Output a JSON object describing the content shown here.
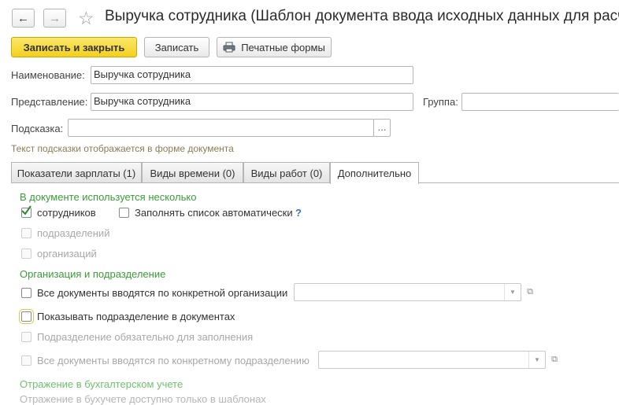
{
  "nav": {
    "back_icon": "arrow-left",
    "forward_icon": "arrow-right",
    "favorite_icon": "star"
  },
  "window": {
    "title": "Выручка сотрудника (Шаблон документа ввода исходных данных для расче"
  },
  "toolbar": {
    "save_close": "Записать и закрыть",
    "save": "Записать",
    "print_forms": "Печатные формы"
  },
  "form": {
    "name_label": "Наименование:",
    "name_value": "Выручка сотрудника",
    "presentation_label": "Представление:",
    "presentation_value": "Выручка сотрудника",
    "group_label": "Группа:",
    "group_value": "",
    "tooltip_label": "Подсказка:",
    "tooltip_value": "",
    "tooltip_select": "...",
    "tooltip_hint": "Текст подсказки отображается в форме документа"
  },
  "tabs": [
    {
      "label": "Показатели зарплаты (1)"
    },
    {
      "label": "Виды времени (0)"
    },
    {
      "label": "Виды работ (0)"
    },
    {
      "label": "Дополнительно"
    }
  ],
  "additional": {
    "section_multiple": "В документе используется несколько",
    "cb_employees": "сотрудников",
    "cb_autofill": "Заполнять список автоматически",
    "help_mark": "?",
    "cb_departments": "подразделений",
    "cb_organizations": "организаций",
    "section_org": "Организация и подразделение",
    "cb_single_org": "Все документы вводятся по конкретной организации",
    "cb_show_department": "Показывать подразделение в документах",
    "cb_department_required": "Подразделение обязательно для заполнения",
    "cb_single_department": "Все документы вводятся по конкретному подразделению",
    "section_accounting": "Отражение в бухгалтерском учете",
    "accounting_note": "Отражение в бухучете доступно только в шаблонах"
  },
  "states": {
    "employees_checked": true,
    "autofill_checked": false,
    "departments_checked": false,
    "organizations_checked": false,
    "single_org_checked": false,
    "show_department_checked": false,
    "department_required_checked": false,
    "single_department_checked": false
  }
}
